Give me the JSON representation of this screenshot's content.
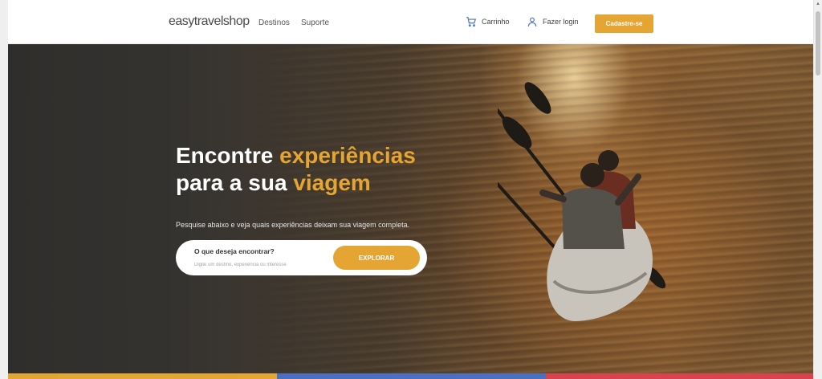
{
  "header": {
    "logo": "easytravelshop",
    "nav": [
      "Destinos",
      "Suporte"
    ],
    "cart_label": "Carrinho",
    "login_label": "Fazer login",
    "signup_label": "Cadastre-se"
  },
  "hero": {
    "title_line1_part1": "Encontre ",
    "title_line1_highlight": "experiências",
    "title_line2_part1": "para a sua ",
    "title_line2_highlight": "viagem",
    "subtitle": "Pesquise abaixo e veja quais experiências deixam sua viagem completa."
  },
  "search": {
    "label": "O que deseja encontrar?",
    "placeholder": "Digite um destino, experiência ou interesse",
    "button": "EXPLORAR"
  },
  "icons": {
    "cart": "shopping-cart-icon",
    "login": "user-icon"
  },
  "colors": {
    "accent": "#e5a533",
    "strip": [
      "#e5a533",
      "#4a6fc3",
      "#d9424f"
    ]
  }
}
